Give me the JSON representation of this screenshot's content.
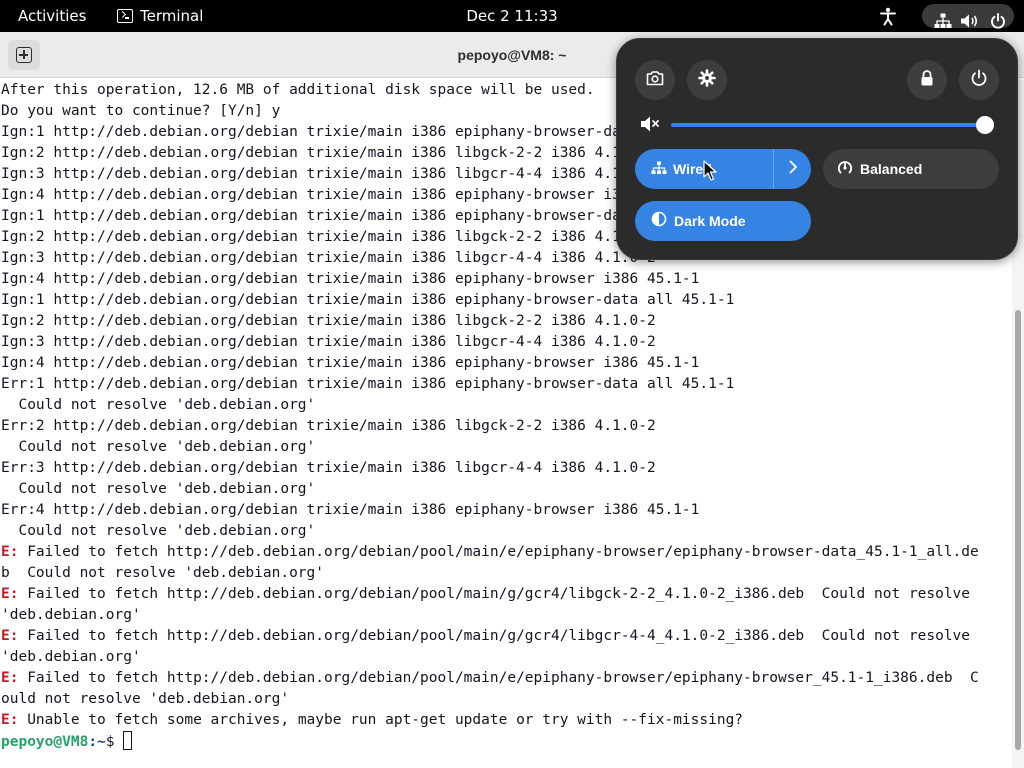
{
  "topbar": {
    "activities": "Activities",
    "app_name": "Terminal",
    "clock": "Dec 2  11:33",
    "icons": [
      "accessibility-icon",
      "network-wired-icon",
      "volume-icon",
      "power-icon"
    ]
  },
  "terminal": {
    "title": "pepoyo@VM8: ~",
    "lines": [
      {
        "tag": "",
        "text": "After this operation, 12.6 MB of additional disk space will be used."
      },
      {
        "tag": "",
        "text": "Do you want to continue? [Y/n] y"
      },
      {
        "tag": "",
        "text": "Ign:1 http://deb.debian.org/debian trixie/main i386 epiphany-browser-data all 45.1-1"
      },
      {
        "tag": "",
        "text": "Ign:2 http://deb.debian.org/debian trixie/main i386 libgck-2-2 i386 4.1.0-2"
      },
      {
        "tag": "",
        "text": "Ign:3 http://deb.debian.org/debian trixie/main i386 libgcr-4-4 i386 4.1.0-2"
      },
      {
        "tag": "",
        "text": "Ign:4 http://deb.debian.org/debian trixie/main i386 epiphany-browser i386 45.1-1"
      },
      {
        "tag": "",
        "text": "Ign:1 http://deb.debian.org/debian trixie/main i386 epiphany-browser-data all 45.1-1"
      },
      {
        "tag": "",
        "text": "Ign:2 http://deb.debian.org/debian trixie/main i386 libgck-2-2 i386 4.1.0-2"
      },
      {
        "tag": "",
        "text": "Ign:3 http://deb.debian.org/debian trixie/main i386 libgcr-4-4 i386 4.1.0-2"
      },
      {
        "tag": "",
        "text": "Ign:4 http://deb.debian.org/debian trixie/main i386 epiphany-browser i386 45.1-1"
      },
      {
        "tag": "",
        "text": "Ign:1 http://deb.debian.org/debian trixie/main i386 epiphany-browser-data all 45.1-1"
      },
      {
        "tag": "",
        "text": "Ign:2 http://deb.debian.org/debian trixie/main i386 libgck-2-2 i386 4.1.0-2"
      },
      {
        "tag": "",
        "text": "Ign:3 http://deb.debian.org/debian trixie/main i386 libgcr-4-4 i386 4.1.0-2"
      },
      {
        "tag": "",
        "text": "Ign:4 http://deb.debian.org/debian trixie/main i386 epiphany-browser i386 45.1-1"
      },
      {
        "tag": "",
        "text": "Err:1 http://deb.debian.org/debian trixie/main i386 epiphany-browser-data all 45.1-1"
      },
      {
        "tag": "",
        "text": "  Could not resolve 'deb.debian.org'"
      },
      {
        "tag": "",
        "text": "Err:2 http://deb.debian.org/debian trixie/main i386 libgck-2-2 i386 4.1.0-2"
      },
      {
        "tag": "",
        "text": "  Could not resolve 'deb.debian.org'"
      },
      {
        "tag": "",
        "text": "Err:3 http://deb.debian.org/debian trixie/main i386 libgcr-4-4 i386 4.1.0-2"
      },
      {
        "tag": "",
        "text": "  Could not resolve 'deb.debian.org'"
      },
      {
        "tag": "",
        "text": "Err:4 http://deb.debian.org/debian trixie/main i386 epiphany-browser i386 45.1-1"
      },
      {
        "tag": "",
        "text": "  Could not resolve 'deb.debian.org'"
      },
      {
        "tag": "E:",
        "text": " Failed to fetch http://deb.debian.org/debian/pool/main/e/epiphany-browser/epiphany-browser-data_45.1-1_all.de"
      },
      {
        "tag": "",
        "text": "b  Could not resolve 'deb.debian.org'"
      },
      {
        "tag": "E:",
        "text": " Failed to fetch http://deb.debian.org/debian/pool/main/g/gcr4/libgck-2-2_4.1.0-2_i386.deb  Could not resolve"
      },
      {
        "tag": "",
        "text": "'deb.debian.org'"
      },
      {
        "tag": "E:",
        "text": " Failed to fetch http://deb.debian.org/debian/pool/main/g/gcr4/libgcr-4-4_4.1.0-2_i386.deb  Could not resolve"
      },
      {
        "tag": "",
        "text": "'deb.debian.org'"
      },
      {
        "tag": "E:",
        "text": " Failed to fetch http://deb.debian.org/debian/pool/main/e/epiphany-browser/epiphany-browser_45.1-1_i386.deb  C"
      },
      {
        "tag": "",
        "text": "ould not resolve 'deb.debian.org'"
      },
      {
        "tag": "E:",
        "text": " Unable to fetch some archives, maybe run apt-get update or try with --fix-missing?"
      }
    ],
    "prompt": {
      "user_host": "pepoyo@VM8",
      "path": ":~",
      "symbol": "$ "
    }
  },
  "quick_settings": {
    "buttons": [
      "screenshot-icon",
      "settings-icon",
      "lock-icon",
      "power-icon"
    ],
    "volume": {
      "muted": true,
      "level": 1.0
    },
    "wired": {
      "label": "Wired",
      "active": true
    },
    "power_mode": {
      "label": "Balanced",
      "active": false
    },
    "dark_mode": {
      "label": "Dark Mode",
      "active": true
    },
    "accent_color": "#3584e4"
  }
}
